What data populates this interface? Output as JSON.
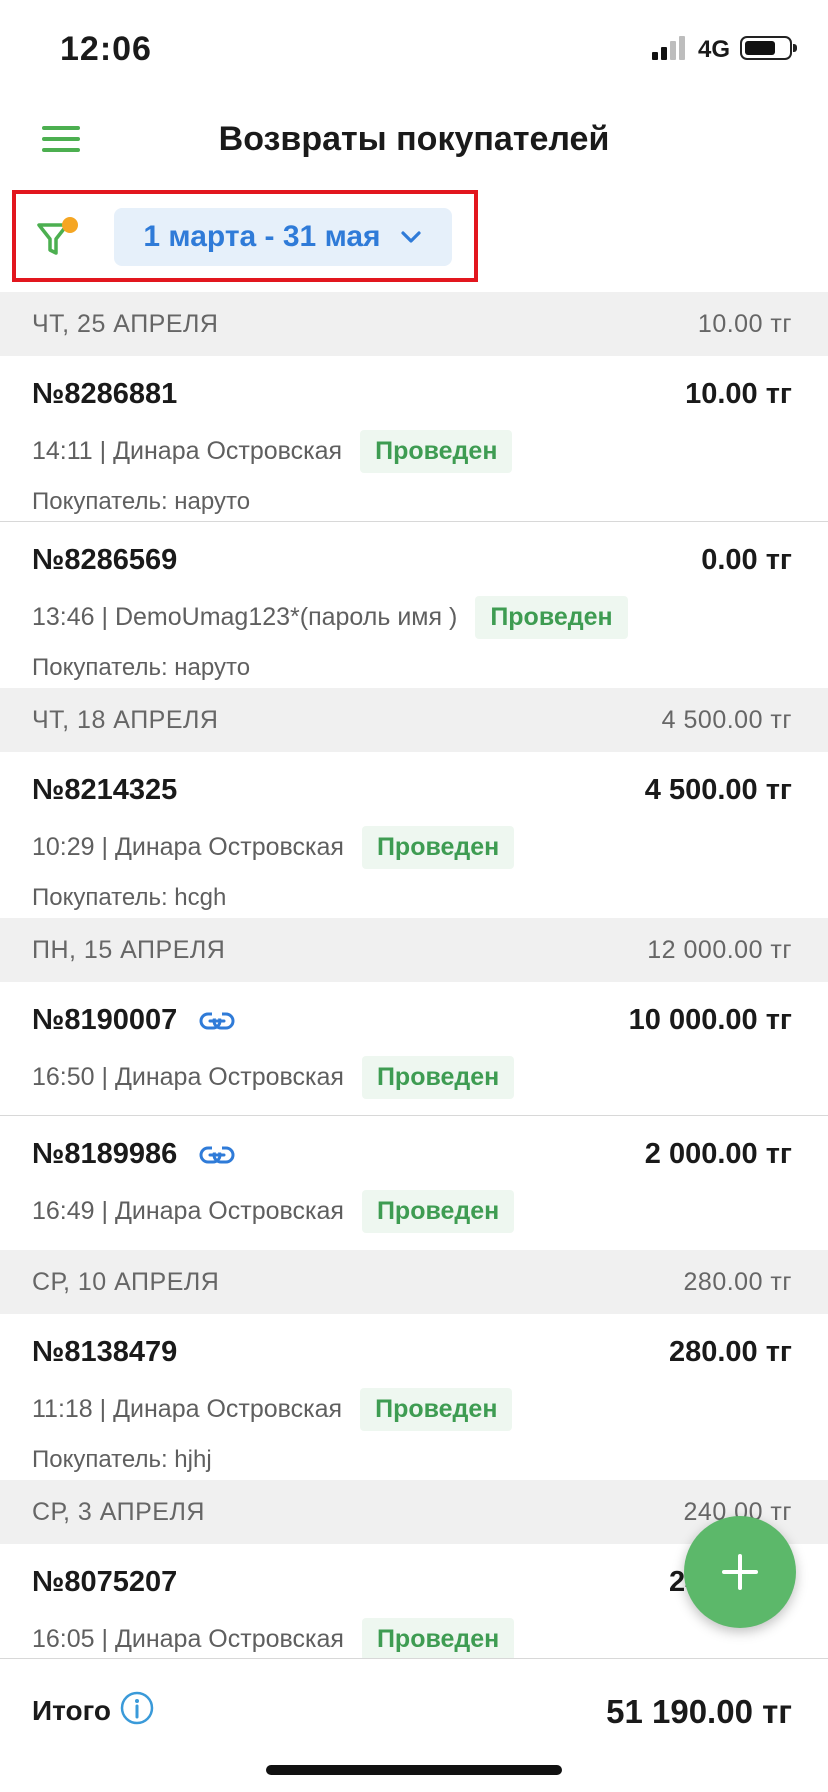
{
  "status_bar": {
    "time": "12:06",
    "network": "4G"
  },
  "header": {
    "title": "Возвраты покупателей"
  },
  "filter": {
    "date_range": "1 марта - 31 мая"
  },
  "days": [
    {
      "date": "ЧТ, 25 АПРЕЛЯ",
      "total": "10.00 тг",
      "items": [
        {
          "number": "№8286881",
          "amount": "10.00 тг",
          "time_user": "14:11 | Динара Островская",
          "status": "Проведен",
          "customer": "Покупатель: наруто"
        },
        {
          "number": "№8286569",
          "amount": "0.00 тг",
          "time_user": "13:46 | DemoUmag123*(пароль имя )",
          "status": "Проведен",
          "customer": "Покупатель: наруто"
        }
      ]
    },
    {
      "date": "ЧТ, 18 АПРЕЛЯ",
      "total": "4 500.00 тг",
      "items": [
        {
          "number": "№8214325",
          "amount": "4 500.00 тг",
          "time_user": "10:29 | Динара Островская",
          "status": "Проведен",
          "customer": "Покупатель: hcgh"
        }
      ]
    },
    {
      "date": "ПН, 15 АПРЕЛЯ",
      "total": "12 000.00 тг",
      "items": [
        {
          "number": "№8190007",
          "amount": "10 000.00 тг",
          "time_user": "16:50 | Динара Островская",
          "status": "Проведен",
          "customer": "",
          "linked": true
        },
        {
          "number": "№8189986",
          "amount": "2 000.00 тг",
          "time_user": "16:49 | Динара Островская",
          "status": "Проведен",
          "customer": "",
          "linked": true
        }
      ]
    },
    {
      "date": "СР, 10 АПРЕЛЯ",
      "total": "280.00 тг",
      "items": [
        {
          "number": "№8138479",
          "amount": "280.00 тг",
          "time_user": "11:18 | Динара Островская",
          "status": "Проведен",
          "customer": "Покупатель: hjhj"
        }
      ]
    },
    {
      "date": "СР, 3 АПРЕЛЯ",
      "total": "240.00 тг",
      "items": [
        {
          "number": "№8075207",
          "amount": "240.00 тг",
          "time_user": "16:05 | Динара Островская",
          "status": "Проведен",
          "customer": ""
        }
      ]
    }
  ],
  "footer": {
    "total_label": "Итого",
    "total_amount": "51 190.00 тг"
  },
  "colors": {
    "accent": "#4caf50",
    "link": "#2f7bd8",
    "status_text": "#3e9c52",
    "highlight_frame": "#e2161e",
    "filter_dot": "#f5a623"
  }
}
